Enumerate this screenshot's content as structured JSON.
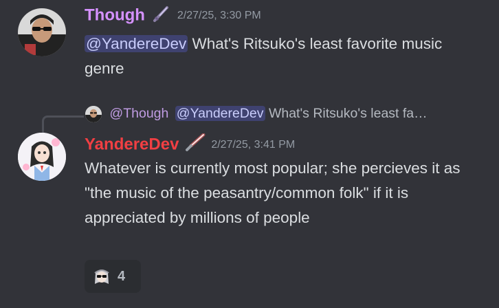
{
  "messages": [
    {
      "username": "Though",
      "username_color": "#d591ff",
      "timestamp": "2/27/25, 3:30 PM",
      "mention": "@YandereDev",
      "text": " What's Ritsuko's least favorite music genre",
      "badge_icon": "dagger-icon"
    },
    {
      "username": "YandereDev",
      "username_color": "#f23f43",
      "timestamp": "2/27/25, 3:41 PM",
      "reply": {
        "user": "@Though",
        "mention": "@YandereDev",
        "text": " What's Ritsuko's least fa…"
      },
      "text": "Whatever is currently most popular; she percieves it as \"the music of the peasantry/common folk\" if it is appreciated by millions of people",
      "badge_icon": "lightsaber-icon",
      "reaction": {
        "emoji": "sunglasses-anime-emoji",
        "count": "4"
      }
    }
  ],
  "colors": {
    "background": "#323339",
    "mention_bg": "#3f4270",
    "mention_text": "#c9cdfb",
    "timestamp": "#949ba4"
  }
}
